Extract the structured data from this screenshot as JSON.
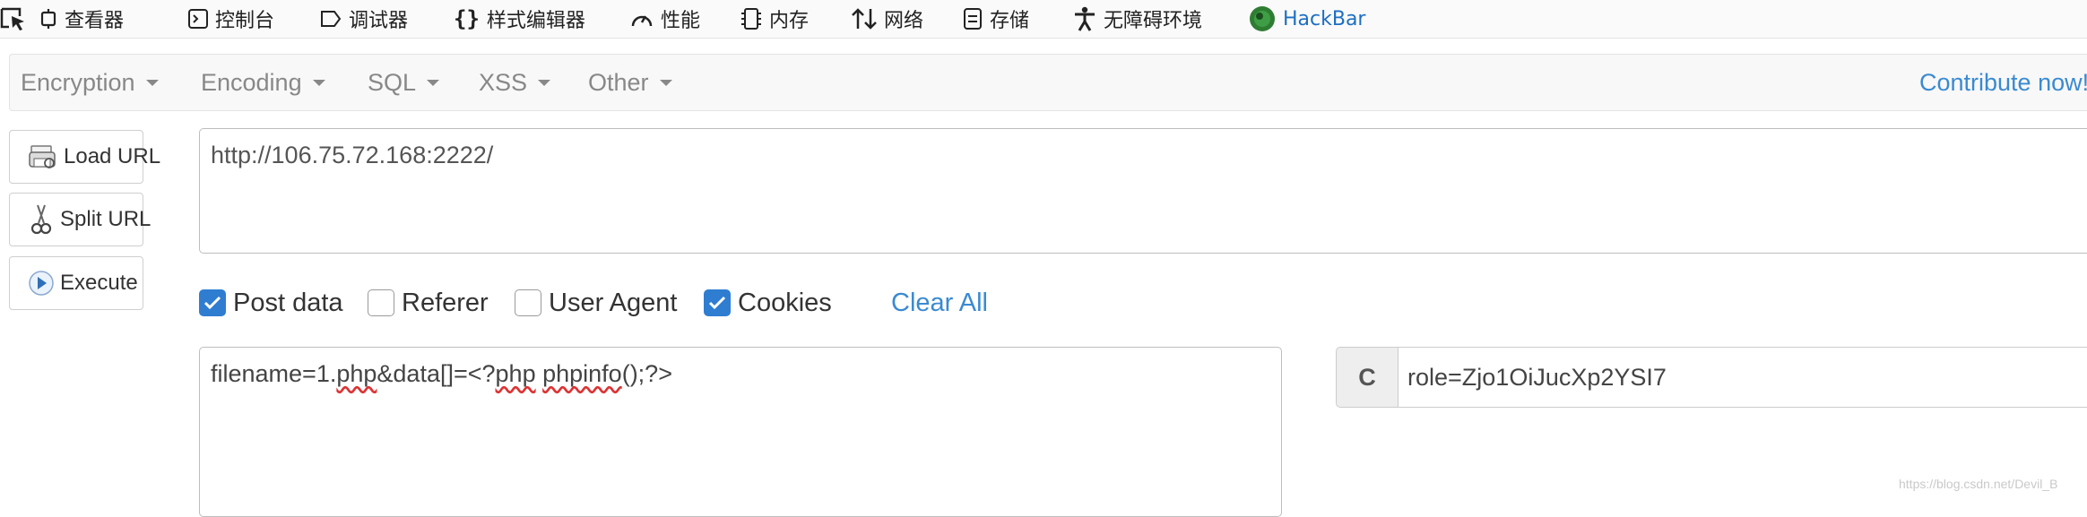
{
  "devtools": {
    "tabs": [
      {
        "label": "查看器",
        "icon": "inspector-icon"
      },
      {
        "label": "控制台",
        "icon": "console-icon"
      },
      {
        "label": "调试器",
        "icon": "debugger-icon"
      },
      {
        "label": "样式编辑器",
        "icon": "style-editor-icon"
      },
      {
        "label": "性能",
        "icon": "performance-icon"
      },
      {
        "label": "内存",
        "icon": "memory-icon"
      },
      {
        "label": "网络",
        "icon": "network-icon"
      },
      {
        "label": "存储",
        "icon": "storage-icon"
      },
      {
        "label": "无障碍环境",
        "icon": "accessibility-icon"
      },
      {
        "label": "HackBar",
        "icon": "hackbar-logo-icon"
      }
    ]
  },
  "hackbar": {
    "menus": [
      "Encryption",
      "Encoding",
      "SQL",
      "XSS",
      "Other"
    ],
    "contribute": "Contribute now!",
    "buttons": {
      "load_url": "Load URL",
      "split_url": "Split URL",
      "execute": "Execute"
    },
    "url": "http://106.75.72.168:2222/",
    "options": {
      "post_data": {
        "label": "Post data",
        "checked": true
      },
      "referer": {
        "label": "Referer",
        "checked": false
      },
      "user_agent": {
        "label": "User Agent",
        "checked": false
      },
      "cookies": {
        "label": "Cookies",
        "checked": true
      }
    },
    "clear_all": "Clear All",
    "post_body": {
      "prefix": "filename=1.",
      "word1": "php",
      "mid1": "&data[]=<?",
      "word2": "php",
      "mid2": " ",
      "word3": "phpinfo",
      "suffix": "();?>"
    },
    "cookie_label": "C",
    "cookie_value": "role=Zjo1OiJucXp2YSI7"
  },
  "watermark": "https://blog.csdn.net/Devil_B",
  "colors": {
    "accent": "#3a8ad1",
    "checkbox_on": "#2f7dd1",
    "hackbar_logo": "#2e7d32"
  }
}
